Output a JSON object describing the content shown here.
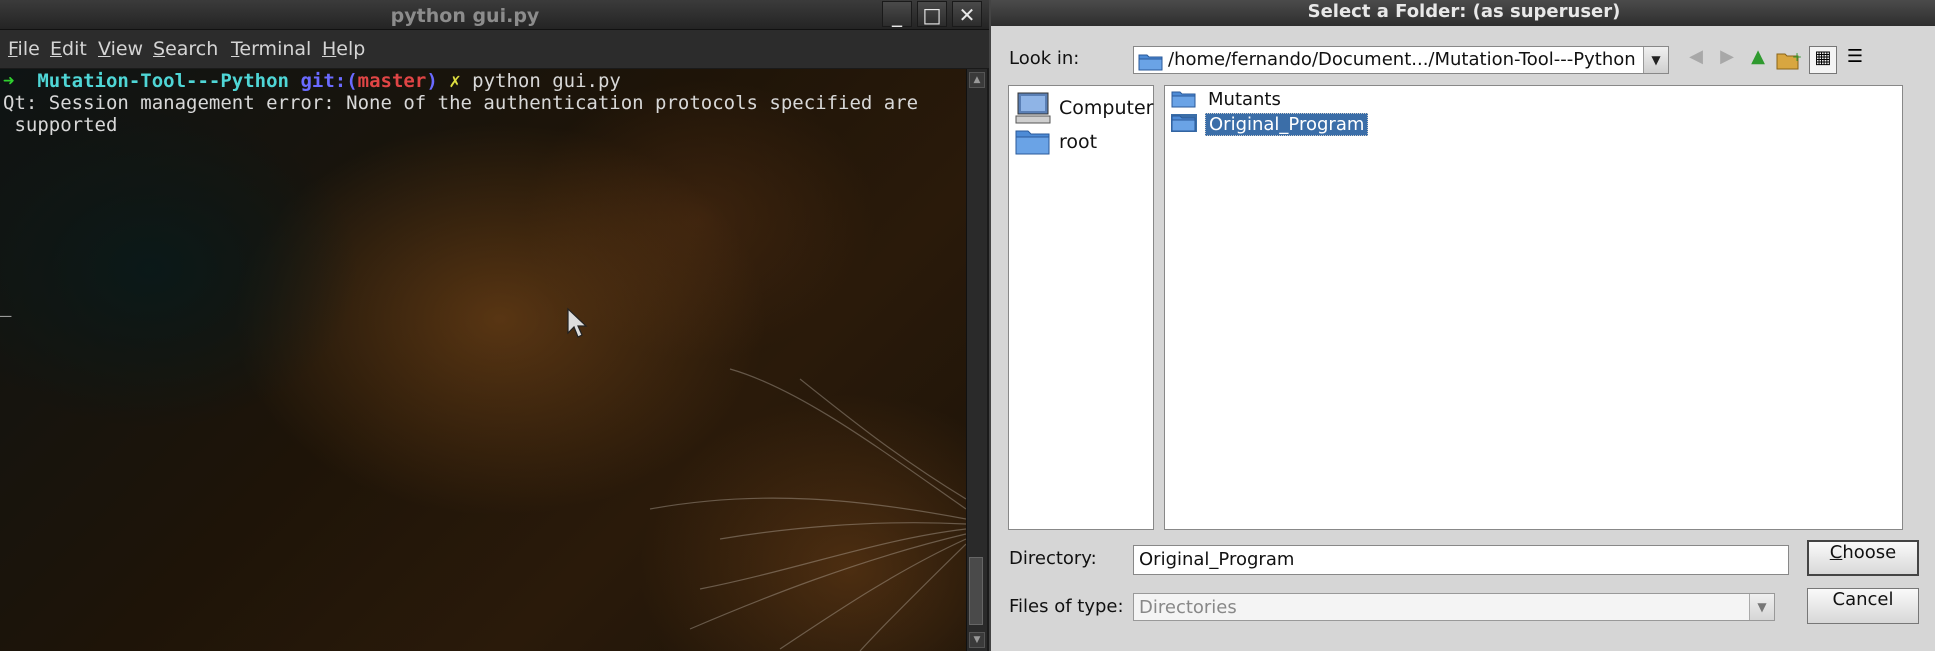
{
  "terminal": {
    "title": "python gui.py",
    "window_buttons": {
      "minimize": "_",
      "maximize": "□",
      "close": "✕"
    },
    "menu": [
      {
        "accel": "F",
        "rest": "ile"
      },
      {
        "accel": "E",
        "rest": "dit"
      },
      {
        "accel": "V",
        "rest": "iew"
      },
      {
        "accel": "S",
        "rest": "earch"
      },
      {
        "accel": "T",
        "rest": "erminal"
      },
      {
        "accel": "H",
        "rest": "elp"
      }
    ],
    "prompt": {
      "arrow": "➜",
      "dir": "Mutation-Tool---Python",
      "git_open": "git:(",
      "branch": "master",
      "git_close": ")",
      "dirty": "✗",
      "command": "python gui.py"
    },
    "output": [
      "Qt: Session management error: None of the authentication protocols specified are",
      " supported"
    ],
    "cursor": "_",
    "colors": {
      "prompt_arrow": "#2fd12f",
      "dir": "#4fd6d6",
      "git": "#6a6aff",
      "branch": "#e04545",
      "dirty": "#e0e040"
    }
  },
  "dialog": {
    "title": "Select a Folder: (as superuser)",
    "look_in_label": "Look in:",
    "look_in_path": "/home/fernando/Document.../Mutation-Tool---Python",
    "toolbar": {
      "back_icon": "◀",
      "forward_icon": "▶",
      "up_icon": "▲",
      "new_folder_icon": "+",
      "icon_view_icon": "▦",
      "detail_view_icon": "☰"
    },
    "sidebar": [
      {
        "label": "Computer",
        "icon": "computer-icon"
      },
      {
        "label": "root",
        "icon": "folder-icon"
      }
    ],
    "files": [
      {
        "label": "Mutants",
        "selected": false
      },
      {
        "label": "Original_Program",
        "selected": true
      }
    ],
    "directory_label": "Directory:",
    "directory_value": "Original_Program",
    "files_of_type_label": "Files of type:",
    "files_of_type_value": "Directories",
    "choose": {
      "accel": "C",
      "rest": "hoose"
    },
    "cancel": "Cancel",
    "colors": {
      "selection": "#3b6ea8",
      "folder": "#4d8bd6"
    }
  }
}
